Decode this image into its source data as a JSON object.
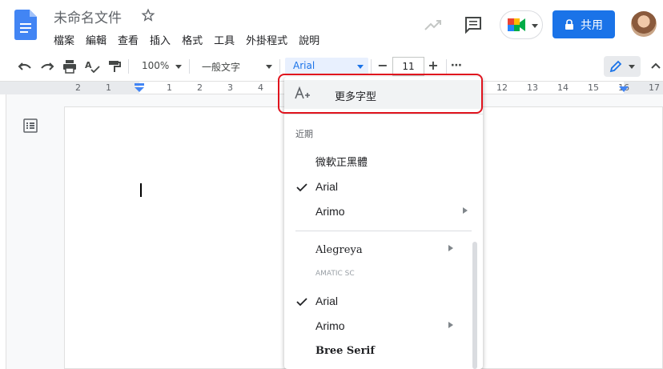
{
  "header": {
    "title": "未命名文件",
    "menu": [
      "檔案",
      "編輯",
      "查看",
      "插入",
      "格式",
      "工具",
      "外掛程式",
      "說明"
    ],
    "share_label": "共用"
  },
  "toolbar": {
    "zoom": "100%",
    "style": "一般文字",
    "font": "Arial",
    "font_size": "11",
    "minus": "−",
    "plus": "+",
    "more": "⋯"
  },
  "ruler": {
    "numbers": [
      "2",
      "1",
      "1",
      "2",
      "3",
      "4",
      "12",
      "13",
      "14",
      "15",
      "16",
      "17"
    ]
  },
  "font_menu": {
    "more_fonts_label": "更多字型",
    "recent_label": "近期",
    "recent": [
      {
        "label": "微軟正黑體",
        "checked": false,
        "submenu": false
      },
      {
        "label": "Arial",
        "checked": true,
        "submenu": false
      },
      {
        "label": "Arimo",
        "checked": false,
        "submenu": true
      }
    ],
    "all": [
      {
        "label": "Alegreya",
        "checked": false,
        "submenu": true
      },
      {
        "label": "AMATIC SC",
        "checked": false,
        "submenu": false
      },
      {
        "label": "Arial",
        "checked": true,
        "submenu": false
      },
      {
        "label": "Arimo",
        "checked": false,
        "submenu": true
      },
      {
        "label": "Bree Serif",
        "checked": false,
        "submenu": false
      }
    ]
  },
  "colors": {
    "accent": "#1a73e8",
    "highlight_border": "#e0141e"
  }
}
